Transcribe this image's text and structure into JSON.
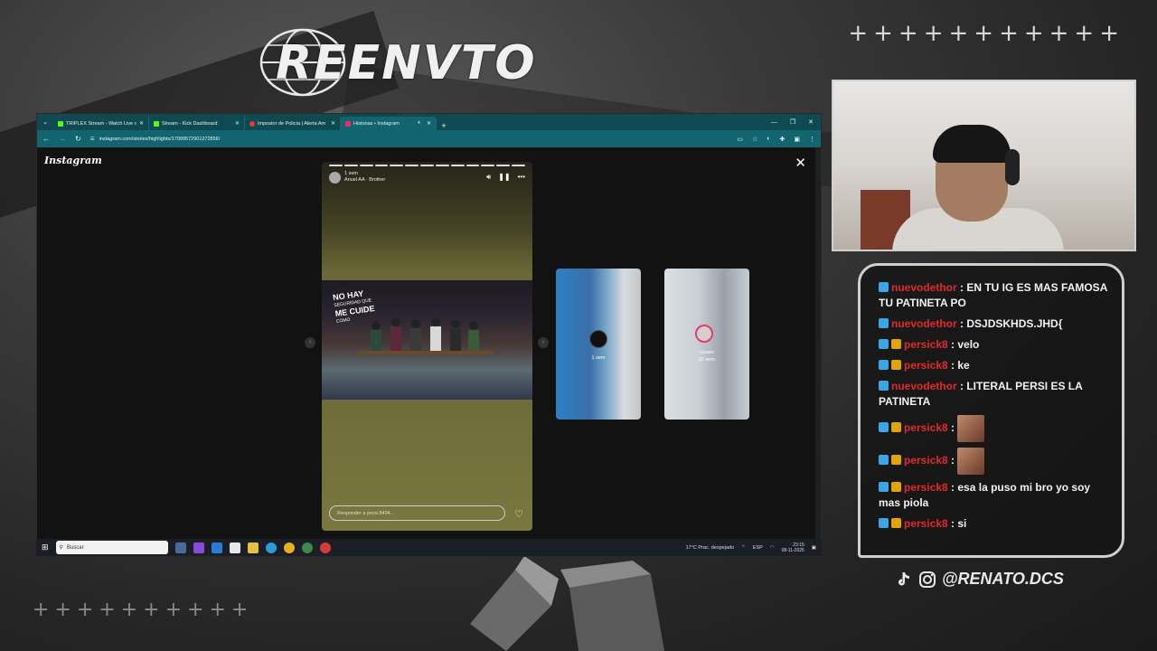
{
  "overlay": {
    "brand": "REENVTO",
    "crosses_top": "+++++++++++",
    "crosses_bottom": "++++++++++",
    "social_handle": "@RENATO.DCS"
  },
  "browser": {
    "tabs": [
      {
        "label": "TRIPLEX Stream - Watch Live o",
        "color": "#53fc18"
      },
      {
        "label": "Stream - Kick Dashboard",
        "color": "#53fc18"
      },
      {
        "label": "Impostor de Policía | Alerta Am",
        "color": "#e53935"
      },
      {
        "label": "Historias • Instagram",
        "color": "#e1306c",
        "active": true
      }
    ],
    "url": "instagram.com/stories/highlights/17999572901372856/"
  },
  "instagram": {
    "logo": "Instagram",
    "story": {
      "time": "1 sem",
      "author": "Anuel AA · Brother",
      "caption_main": "NO HAY",
      "caption_sub": "SEGURIDAD QUE",
      "caption_end": "ME CUIDE",
      "caption_tail": "COMO",
      "reply_placeholder": "Responder a persi.8494..."
    },
    "thumbs": [
      {
        "label": "",
        "time": "1 sem"
      },
      {
        "label": "clases",
        "time": "32 sem"
      }
    ]
  },
  "taskbar": {
    "search": "Buscar",
    "weather": "17°C  Prac. despejado",
    "lang": "ESP",
    "time": "23:15",
    "date": "08-11-2025"
  },
  "chat": {
    "messages": [
      {
        "user": "nuevodethor",
        "text": "EN TU IG ES MAS FAMOSA TU PATINETA PO",
        "badges": [
          "blue"
        ]
      },
      {
        "user": "nuevodethor",
        "text": "DSJDSKHDS.JHD{",
        "badges": [
          "blue"
        ]
      },
      {
        "user": "persick8",
        "text": "velo",
        "badges": [
          "blue",
          "gold"
        ]
      },
      {
        "user": "persick8",
        "text": "ke",
        "badges": [
          "blue",
          "gold"
        ]
      },
      {
        "user": "nuevodethor",
        "text": "LITERAL PERSI ES LA PATINETA",
        "badges": [
          "blue"
        ]
      },
      {
        "user": "persick8",
        "text": "",
        "badges": [
          "blue",
          "gold"
        ],
        "emote": "emote"
      },
      {
        "user": "persick8",
        "text": "",
        "badges": [
          "blue",
          "gold"
        ],
        "emote": "emote"
      },
      {
        "user": "persick8",
        "text": "esa la puso mi bro yo soy mas piola",
        "badges": [
          "blue",
          "gold"
        ]
      },
      {
        "user": "persick8",
        "text": "si",
        "badges": [
          "blue",
          "gold"
        ]
      }
    ]
  },
  "icons": {
    "close": "close-icon",
    "heart": "heart-icon",
    "mute": "volume-icon",
    "pause": "pause-icon",
    "more": "more-icon"
  }
}
